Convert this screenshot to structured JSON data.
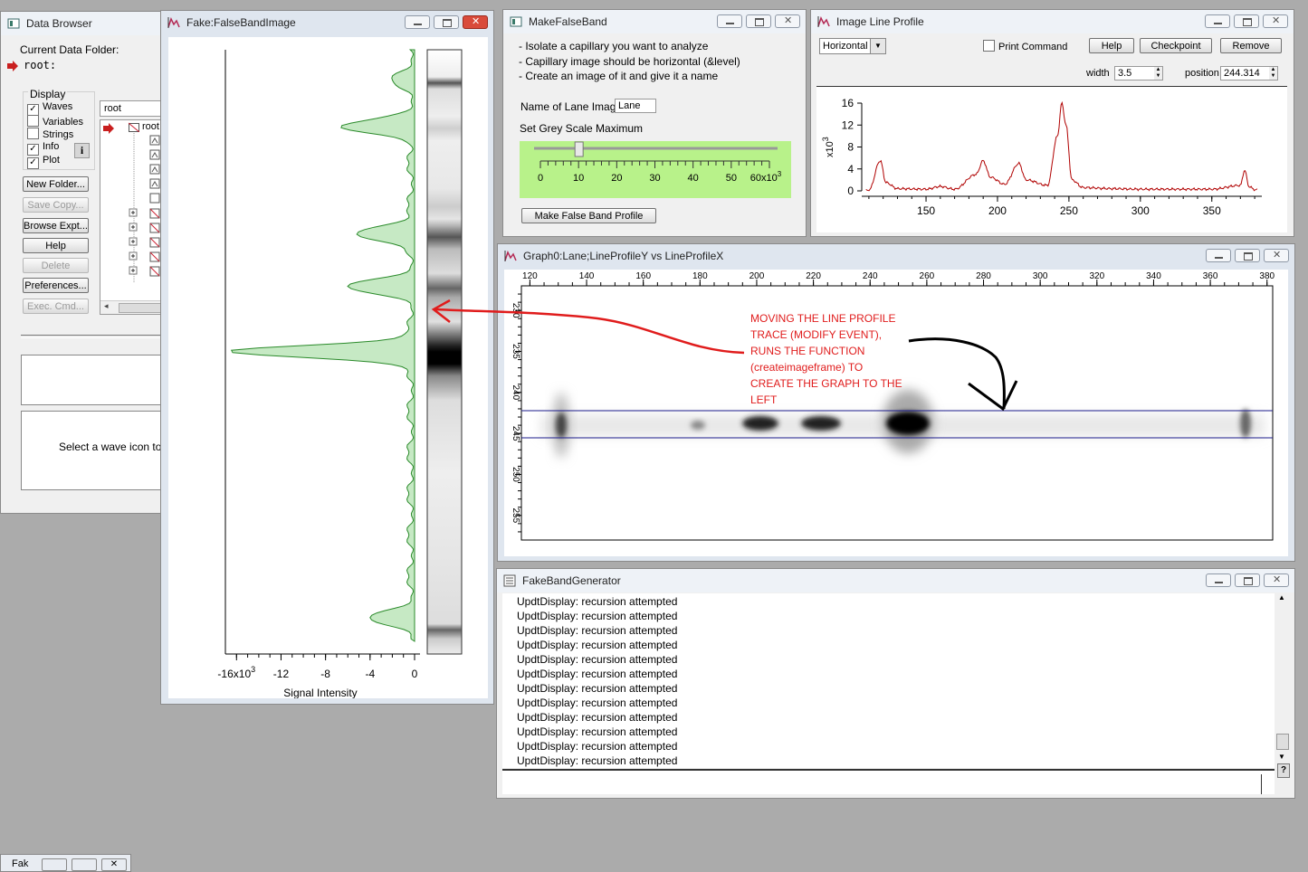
{
  "data_browser": {
    "title": "Data Browser",
    "current_folder_label": "Current Data Folder:",
    "current_folder": "root:",
    "display_label": "Display",
    "display_options": [
      {
        "label": "Waves",
        "checked": true
      },
      {
        "label": "Variables",
        "checked": false
      },
      {
        "label": "Strings",
        "checked": false
      },
      {
        "label": "Info",
        "checked": true
      },
      {
        "label": "Plot",
        "checked": true
      }
    ],
    "folder_select": "root",
    "tree_root": "root",
    "buttons": [
      "New Folder...",
      "Save Copy...",
      "Browse Expt...",
      "Help",
      "Delete",
      "Preferences...",
      "Exec. Cmd..."
    ],
    "info_text": "Select a wave icon to"
  },
  "fake_band": {
    "title": "Fake:FalseBandImage",
    "x_ticks": [
      "-16x10",
      "-12",
      "-8",
      "-4",
      "0"
    ],
    "x_exp": "3",
    "xlabel": "Signal Intensity"
  },
  "make_false_band": {
    "title": "MakeFalseBand",
    "instructions": [
      "- Isolate a capillary you want to analyze",
      "- Capillary image should be horizontal (&level)",
      "- Create an image of it and give it a name"
    ],
    "lane_label": "Name of Lane Image",
    "lane_value": "Lane",
    "grey_label": "Set Grey Scale Maximum",
    "slider_ticks": [
      "0",
      "10",
      "20",
      "30",
      "40",
      "50",
      "60x10"
    ],
    "slider_exp": "3",
    "slider_value": 10,
    "button": "Make False Band Profile"
  },
  "line_profile": {
    "title": "Image Line Profile",
    "orientation": "Horizontal",
    "print_command": "Print Command",
    "help": "Help",
    "checkpoint": "Checkpoint",
    "remove": "Remove",
    "width_label": "width",
    "width_value": "3.5",
    "position_label": "position",
    "position_value": "244.314",
    "y_ticks": [
      "16",
      "12",
      "8",
      "4",
      "0"
    ],
    "y_exp_label": "x10",
    "y_exp": "3",
    "x_ticks": [
      "150",
      "200",
      "250",
      "300",
      "350"
    ]
  },
  "graph0": {
    "title": "Graph0:Lane;LineProfileY vs LineProfileX",
    "x_ticks": [
      "120",
      "140",
      "160",
      "180",
      "200",
      "220",
      "240",
      "260",
      "280",
      "300",
      "320",
      "340",
      "360",
      "380"
    ],
    "y_ticks": [
      "230",
      "235",
      "240",
      "245",
      "250",
      "255"
    ],
    "annotation": [
      "MOVING THE LINE PROFILE",
      "TRACE (MODIFY EVENT),",
      "RUNS THE FUNCTION",
      "(createimageframe) TO",
      "CREATE THE GRAPH TO THE",
      "LEFT"
    ]
  },
  "fake_band_generator": {
    "title": "FakeBandGenerator",
    "lines": [
      "UpdtDisplay: recursion attempted",
      "UpdtDisplay: recursion attempted",
      "UpdtDisplay: recursion attempted",
      "UpdtDisplay: recursion attempted",
      "UpdtDisplay: recursion attempted",
      "UpdtDisplay: recursion attempted",
      "UpdtDisplay: recursion attempted",
      "UpdtDisplay: recursion attempted",
      "UpdtDisplay: recursion attempted",
      "UpdtDisplay: recursion attempted",
      "UpdtDisplay: recursion attempted",
      "UpdtDisplay: recursion attempted"
    ]
  },
  "taskbar_item": "Fak",
  "chart_data": [
    {
      "type": "line",
      "title": "Image Line Profile",
      "x": [
        110,
        118,
        122,
        130,
        150,
        160,
        170,
        185,
        190,
        195,
        205,
        215,
        220,
        235,
        242,
        245,
        248,
        252,
        260,
        280,
        300,
        350,
        370,
        373,
        376,
        380
      ],
      "values": [
        0.1,
        5.5,
        1.5,
        0.4,
        0.3,
        0.8,
        0.3,
        3.0,
        5.5,
        2.5,
        1.2,
        5.0,
        2.0,
        1.0,
        10.0,
        16.0,
        12.0,
        2.0,
        0.6,
        0.4,
        0.3,
        0.3,
        1.0,
        3.8,
        0.8,
        0.2
      ],
      "xlim": [
        105,
        385
      ],
      "ylim": [
        0,
        16
      ],
      "color": "#b00000"
    },
    {
      "type": "area",
      "title": "Fake:FalseBandImage",
      "xlabel": "Signal Intensity",
      "xlim": [
        -17,
        0
      ],
      "band_position_pct": [
        5,
        13,
        31,
        40,
        51,
        96
      ],
      "band_intensity": [
        -1.5,
        -6.0,
        -5.0,
        -5.5,
        -16.5,
        -3.5
      ],
      "fill": "#c6e9c4",
      "stroke": "#2a8a2a"
    }
  ]
}
